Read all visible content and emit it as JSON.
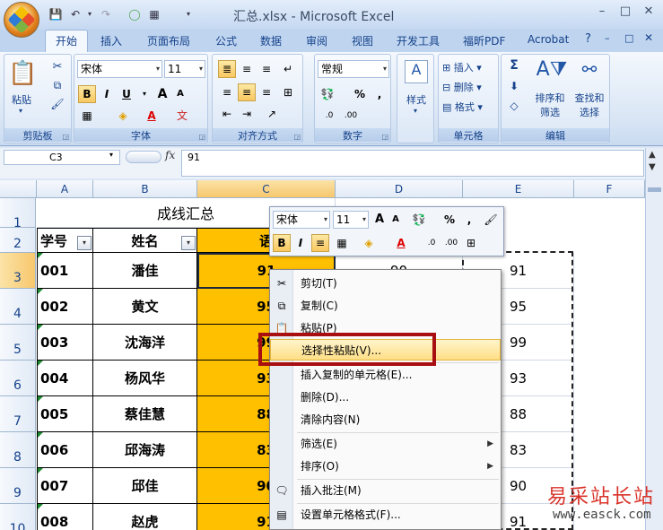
{
  "window": {
    "title": "汇总.xlsx - Microsoft Excel",
    "min": "–",
    "max": "□",
    "close": "✕"
  },
  "qat": {
    "save_icon": "save-icon",
    "undo_icon": "undo-icon",
    "redo_icon": "redo-icon",
    "custom_icon": "customize-icon"
  },
  "tabs": [
    "开始",
    "插入",
    "页面布局",
    "公式",
    "数据",
    "审阅",
    "视图",
    "开发工具",
    "福昕PDF",
    "Acrobat"
  ],
  "ribbon": {
    "clipboard": {
      "label": "剪贴板",
      "paste": "粘贴"
    },
    "font": {
      "label": "字体",
      "font_name": "宋体",
      "font_size": "11",
      "bold": "B",
      "italic": "I",
      "underline": "U",
      "grow": "A",
      "shrink": "A",
      "phonetic": "文"
    },
    "align": {
      "label": "对齐方式"
    },
    "number": {
      "label": "数字",
      "format": "常规",
      "percent": "%",
      "comma": ","
    },
    "styles": {
      "label": "样式",
      "btn": "样式"
    },
    "cells": {
      "label": "单元格",
      "insert": "插入",
      "delete": "删除",
      "format": "格式"
    },
    "edit": {
      "label": "编辑",
      "sort": "排序和",
      "sort2": "筛选",
      "find": "查找和",
      "find2": "选择",
      "sigma": "Σ"
    }
  },
  "formula": {
    "namebox": "C3",
    "fx": "fx",
    "value": "91"
  },
  "columns": [
    "A",
    "B",
    "C",
    "D",
    "E",
    "F"
  ],
  "rows": [
    "1",
    "2",
    "3",
    "4",
    "5",
    "6",
    "7",
    "8",
    "9",
    "10"
  ],
  "sheet": {
    "title": "成线汇总",
    "headers": {
      "a": "学号",
      "b": "姓名",
      "c": "语"
    },
    "data": [
      {
        "id": "001",
        "name": "潘佳",
        "c": "91",
        "d": "90",
        "e": "91"
      },
      {
        "id": "002",
        "name": "黄文",
        "c": "95",
        "d": "",
        "e": "95"
      },
      {
        "id": "003",
        "name": "沈海洋",
        "c": "99",
        "d": "",
        "e": "99"
      },
      {
        "id": "004",
        "name": "杨风华",
        "c": "93",
        "d": "",
        "e": "93"
      },
      {
        "id": "005",
        "name": "蔡佳慧",
        "c": "88",
        "d": "",
        "e": "88"
      },
      {
        "id": "006",
        "name": "邱海涛",
        "c": "83",
        "d": "",
        "e": "83"
      },
      {
        "id": "007",
        "name": "邱佳",
        "c": "90",
        "d": "",
        "e": "90"
      },
      {
        "id": "008",
        "name": "赵虎",
        "c": "91",
        "d": "",
        "e": "91"
      }
    ]
  },
  "mini_toolbar": {
    "font": "宋体",
    "size": "11",
    "bold": "B",
    "italic": "I",
    "percent": "%",
    "comma": ","
  },
  "context_menu": [
    {
      "label": "剪切(T)",
      "icon": "scissors-icon"
    },
    {
      "label": "复制(C)",
      "icon": "copy-icon"
    },
    {
      "label": "粘贴(P)",
      "icon": "paste-icon"
    },
    {
      "label": "选择性粘贴(V)...",
      "icon": ""
    },
    {
      "label": "插入复制的单元格(E)...",
      "icon": ""
    },
    {
      "label": "删除(D)...",
      "icon": ""
    },
    {
      "label": "清除内容(N)",
      "icon": ""
    },
    {
      "label": "筛选(E)",
      "icon": ""
    },
    {
      "label": "排序(O)",
      "icon": ""
    },
    {
      "label": "插入批注(M)",
      "icon": "comment-icon"
    },
    {
      "label": "设置单元格格式(F)...",
      "icon": "format-cells-icon"
    }
  ],
  "watermark": {
    "cn": "易采站长站",
    "url": "www.easck.com"
  }
}
